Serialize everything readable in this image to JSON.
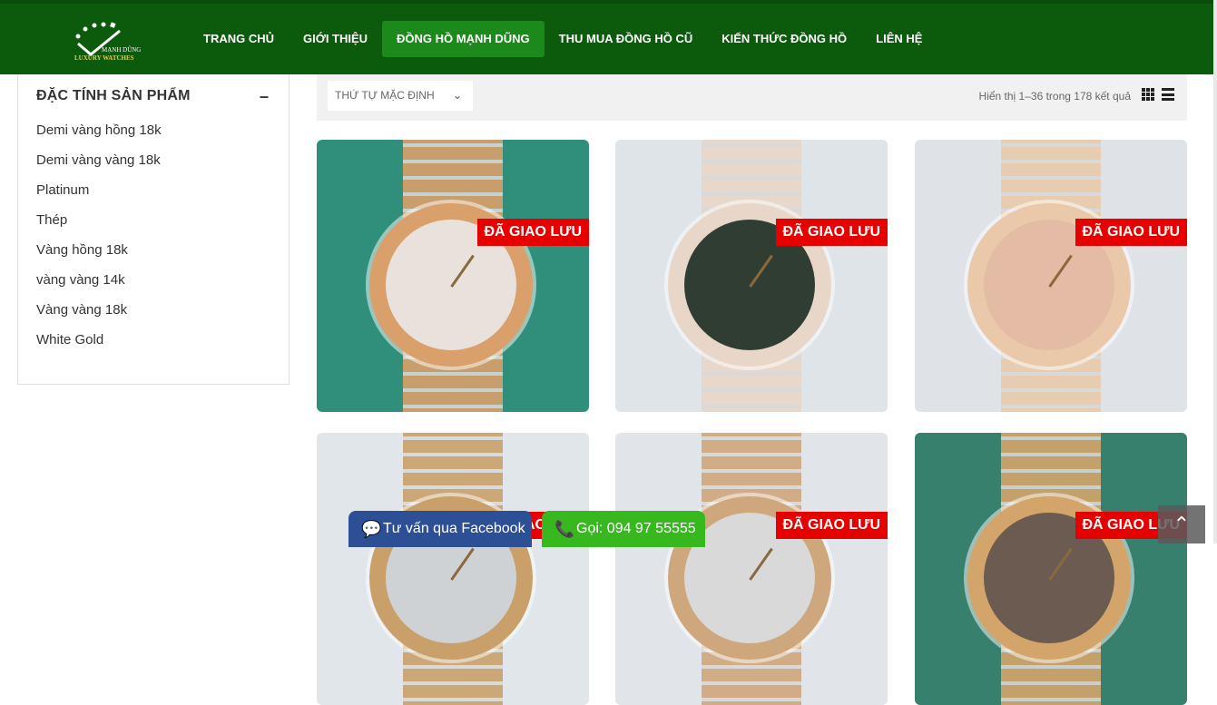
{
  "logo": {
    "brand": "MẠNH DŨNG",
    "sub": "LUXURY WATCHES"
  },
  "nav": [
    {
      "label": "TRANG CHỦ"
    },
    {
      "label": "GIỚI THIỆU"
    },
    {
      "label": "ĐỒNG HỒ MẠNH DŨNG",
      "active": true
    },
    {
      "label": "THU MUA ĐỒNG HỒ CŨ"
    },
    {
      "label": "KIẾN THỨC ĐỒNG HỒ"
    },
    {
      "label": "LIÊN HỆ"
    }
  ],
  "sidebar": {
    "title": "ĐẶC TÍNH SẢN PHẨM",
    "items": [
      {
        "label": "Demi vàng hồng 18k"
      },
      {
        "label": "Demi vàng vàng 18k"
      },
      {
        "label": "Platinum"
      },
      {
        "label": "Thép"
      },
      {
        "label": "Vàng hồng 18k"
      },
      {
        "label": "vàng vàng 14k"
      },
      {
        "label": "Vàng vàng 18k"
      },
      {
        "label": "White Gold"
      }
    ]
  },
  "toolbar": {
    "sort_label": "THỨ TỰ MẶC ĐỊNH",
    "result_count": "Hiển thị 1–36 trong 178 kết quả"
  },
  "products": [
    {
      "badge": "ĐÃ GIAO LƯU",
      "bg": "#2f8f7a",
      "dial": "#e9e2dc",
      "bezel": "#d9a06b"
    },
    {
      "badge": "ĐÃ GIAO LƯU",
      "bg": "#dfe4e8",
      "dial": "#2f3d33",
      "bezel": "#e8d7c8"
    },
    {
      "badge": "ĐÃ GIAO LƯU",
      "bg": "#dfe3e8",
      "dial": "#e4bca6",
      "bezel": "#e9c9a9"
    },
    {
      "badge": "ĐÃ GIAO LƯU",
      "bg": "#e1e6ea",
      "dial": "#cfd2d4",
      "bezel": "#c9a06a"
    },
    {
      "badge": "ĐÃ GIAO LƯU",
      "bg": "#e1e4e8",
      "dial": "#d9d9d9",
      "bezel": "#cfa77c"
    },
    {
      "badge": "ĐÃ GIAO LƯU",
      "bg": "#38806e",
      "dial": "#6b5b50",
      "bezel": "#d4a56b"
    }
  ],
  "float_buttons": {
    "facebook": "Tư vấn qua Facebook",
    "call": "Gọi: 094 97 55555"
  }
}
